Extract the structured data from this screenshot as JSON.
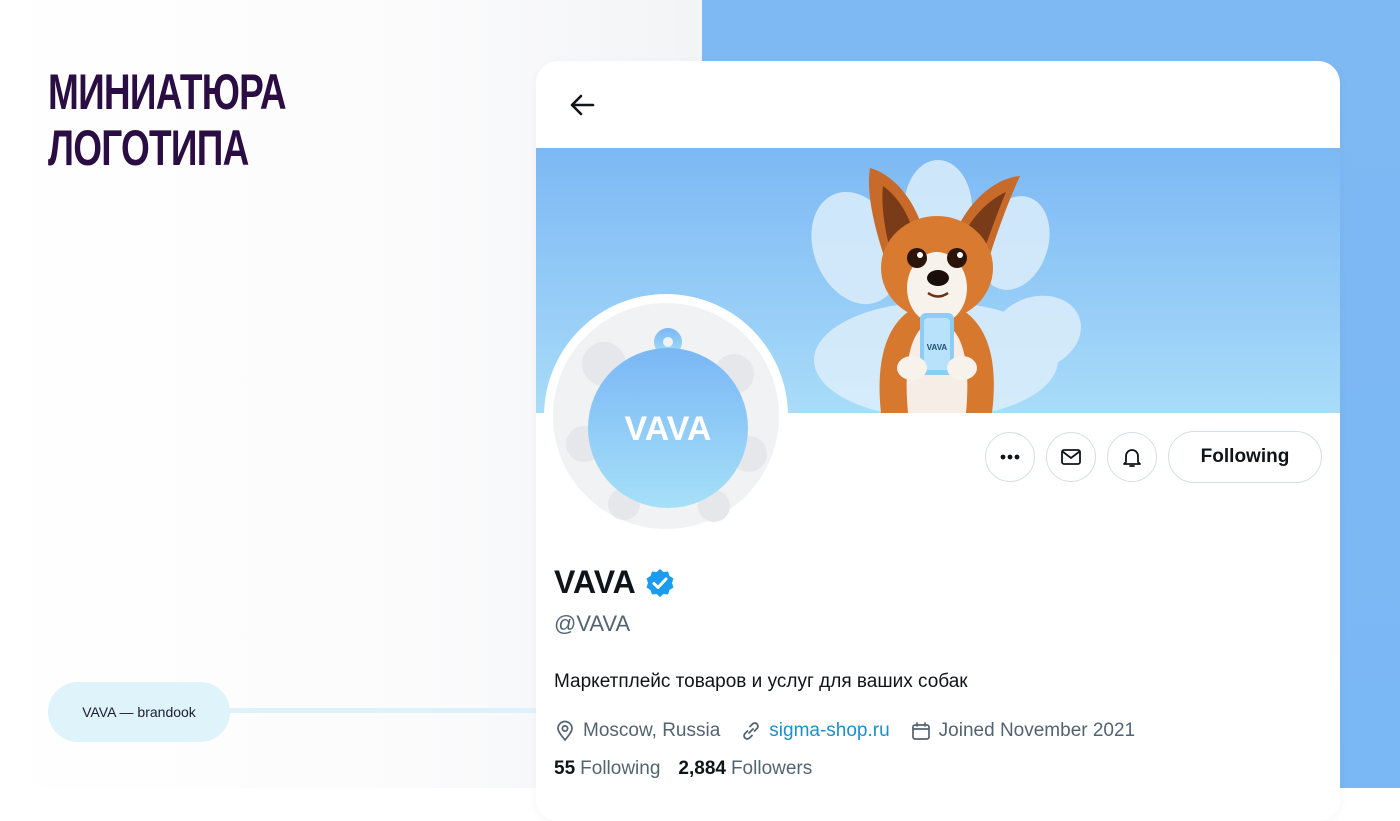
{
  "slide": {
    "title_line1": "Миниатюра",
    "title_line2": "логотипа",
    "brand_tag": "VAVA — brandook"
  },
  "colors": {
    "title": "#2a0d42",
    "right_panel": "#7ab7f5",
    "banner_top": "#7cb8f4",
    "banner_bottom": "#a9dcf9",
    "verified": "#1d9bf0",
    "link": "#1d8fcc"
  },
  "profile": {
    "back_icon": "arrow-left-icon",
    "logo_text": "VAVA",
    "phone_text": "VAVA",
    "actions": {
      "more_icon": "more-horizontal-icon",
      "message_icon": "mail-icon",
      "notify_icon": "bell-icon",
      "follow_label": "Following"
    },
    "name": "VAVA",
    "verified_icon": "verified-badge-icon",
    "handle": "@VAVA",
    "bio": "Маркетплейс товаров и услуг для ваших собак",
    "location": "Moscow, Russia",
    "website": "sigma-shop.ru",
    "joined": "Joined November 2021",
    "following_count": "55",
    "following_label": "Following",
    "followers_count": "2,884",
    "followers_label": "Followers"
  }
}
